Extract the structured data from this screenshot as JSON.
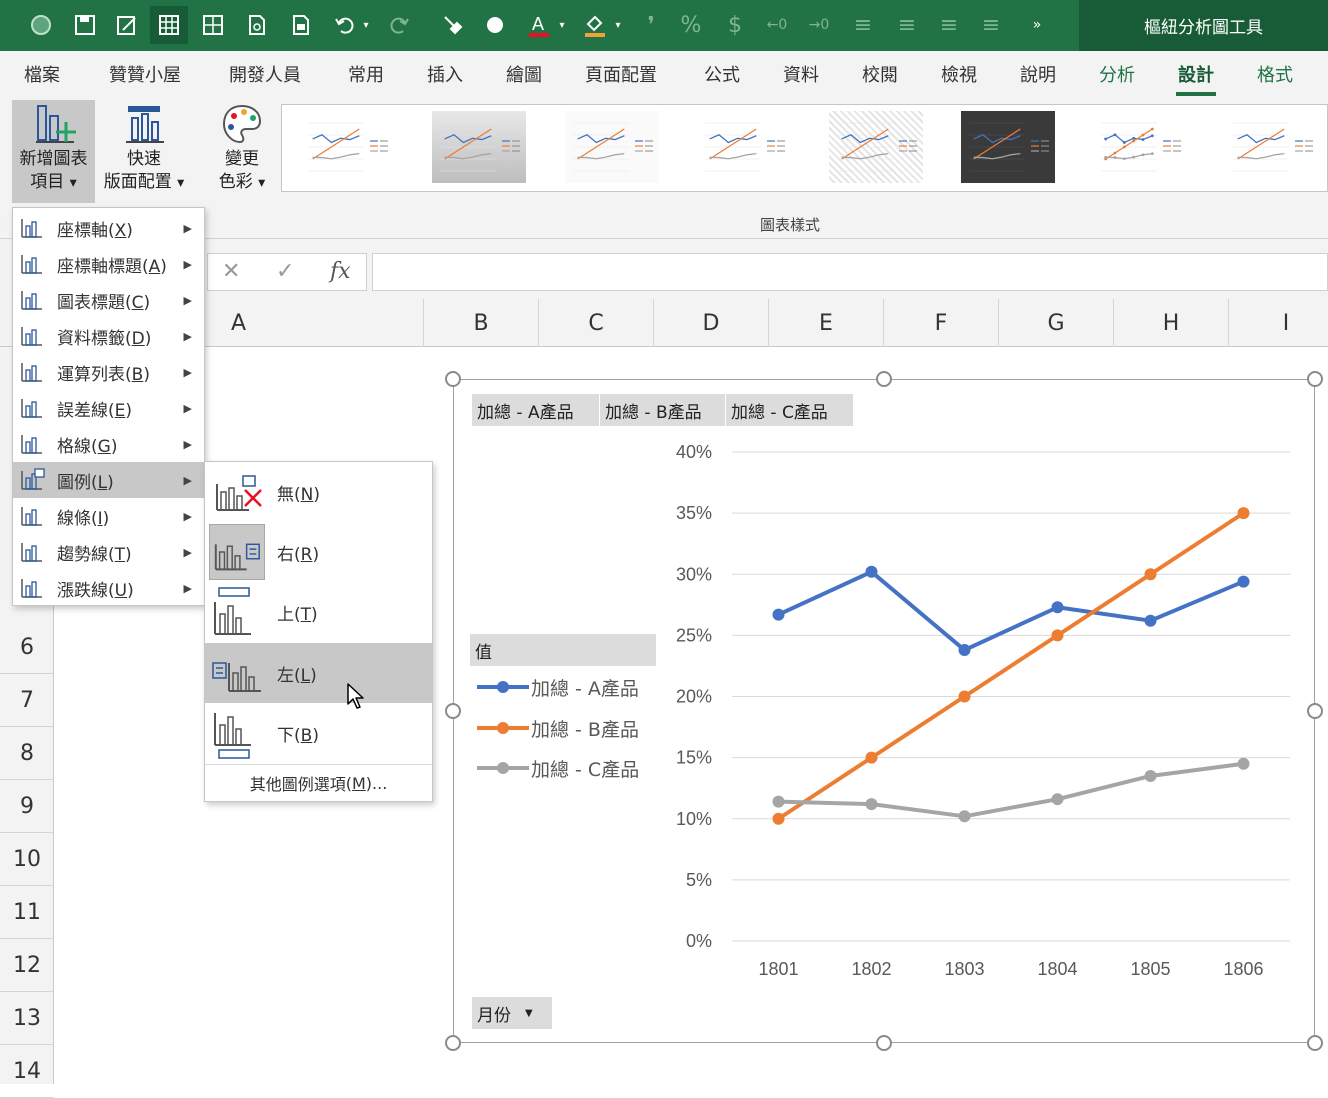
{
  "window": {
    "context_title": "樞紐分析圖工具"
  },
  "ribbon_tabs": [
    {
      "label": "檔案"
    },
    {
      "label": "贊贊小屋"
    },
    {
      "label": "開發人員"
    },
    {
      "label": "常用"
    },
    {
      "label": "插入"
    },
    {
      "label": "繪圖"
    },
    {
      "label": "頁面配置"
    },
    {
      "label": "公式"
    },
    {
      "label": "資料"
    },
    {
      "label": "校閱"
    },
    {
      "label": "檢視"
    },
    {
      "label": "說明"
    },
    {
      "label": "分析"
    },
    {
      "label": "設計"
    },
    {
      "label": "格式"
    }
  ],
  "ribbon": {
    "add_element": {
      "line1": "新增圖表",
      "line2": "項目"
    },
    "quick_layout": {
      "line1": "快速",
      "line2": "版面配置"
    },
    "change_colors": {
      "line1": "變更",
      "line2": "色彩"
    },
    "group_label": "圖表樣式"
  },
  "formula_bar": {
    "cancel": "✕",
    "enter": "✓",
    "fx": "fx",
    "value": ""
  },
  "columns": [
    "A",
    "B",
    "C",
    "D",
    "E",
    "F",
    "G",
    "H",
    "I"
  ],
  "rows": [
    "6",
    "7",
    "8",
    "9",
    "10",
    "11",
    "12",
    "13",
    "14"
  ],
  "add_element_menu": [
    {
      "label": "座標軸",
      "key": "X"
    },
    {
      "label": "座標軸標題",
      "key": "A"
    },
    {
      "label": "圖表標題",
      "key": "C"
    },
    {
      "label": "資料標籤",
      "key": "D"
    },
    {
      "label": "運算列表",
      "key": "B"
    },
    {
      "label": "誤差線",
      "key": "E"
    },
    {
      "label": "格線",
      "key": "G"
    },
    {
      "label": "圖例",
      "key": "L"
    },
    {
      "label": "線條",
      "key": "I"
    },
    {
      "label": "趨勢線",
      "key": "T"
    },
    {
      "label": "漲跌線",
      "key": "U"
    }
  ],
  "legend_menu": {
    "items": [
      {
        "label": "無",
        "key": "N"
      },
      {
        "label": "右",
        "key": "R"
      },
      {
        "label": "上",
        "key": "T"
      },
      {
        "label": "左",
        "key": "L"
      },
      {
        "label": "下",
        "key": "B"
      }
    ],
    "more": {
      "label": "其他圖例選項",
      "key": "M",
      "suffix": "..."
    }
  },
  "chart": {
    "field_buttons": {
      "series": [
        "加總 - A產品",
        "加總 - B產品",
        "加總 - C產品"
      ],
      "values": "值",
      "axis": "月份"
    }
  },
  "chart_data": {
    "type": "line",
    "categories": [
      "1801",
      "1802",
      "1803",
      "1804",
      "1805",
      "1806"
    ],
    "y_ticks": [
      "0%",
      "5%",
      "10%",
      "15%",
      "20%",
      "25%",
      "30%",
      "35%",
      "40%"
    ],
    "ylim": [
      0,
      40
    ],
    "grid": true,
    "legend_position": "left",
    "series": [
      {
        "name": "加總 - A產品",
        "color": "#4472c4",
        "values": [
          26.7,
          30.2,
          23.8,
          27.3,
          26.2,
          29.4
        ]
      },
      {
        "name": "加總 - B產品",
        "color": "#ed7d31",
        "values": [
          10,
          15,
          20,
          25,
          30,
          35
        ]
      },
      {
        "name": "加總 - C產品",
        "color": "#a5a5a5",
        "values": [
          11.4,
          11.2,
          10.2,
          11.6,
          13.5,
          14.5
        ]
      }
    ]
  },
  "colors": {
    "excel_green": "#217346",
    "menu_highlight": "#c8c8c8"
  }
}
